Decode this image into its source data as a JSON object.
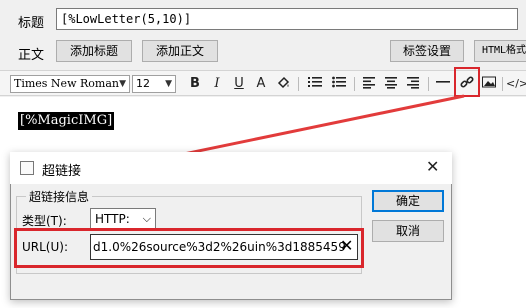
{
  "editor": {
    "title_label": "标题",
    "title_value": "[%LowLetter(5,10)]",
    "body_label": "正文",
    "add_title_btn": "添加标题",
    "add_body_btn": "添加正文",
    "tag_settings_btn": "标签设置",
    "html_btn": "HTML格式"
  },
  "toolbar": {
    "font": "Times New Roman",
    "size": "12",
    "bold": "B",
    "italic": "I",
    "underline": "U",
    "font_color": "A",
    "icons": [
      "bold-icon",
      "italic-icon",
      "underline-icon",
      "font-color-icon",
      "highlight-icon",
      "ordered-list-icon",
      "unordered-list-icon",
      "align-left-icon",
      "align-center-icon",
      "align-right-icon",
      "horizontal-rule-icon",
      "link-icon",
      "image-icon",
      "code-icon"
    ]
  },
  "document": {
    "magic_text": "[%MagicIMG]"
  },
  "dialog": {
    "title": "超链接",
    "group_label": "超链接信息",
    "type_label": "类型(T):",
    "type_value": "HTTP:",
    "url_label": "URL(U):",
    "url_value": "d1.0%26source%3d2%26uin%3d1885459",
    "ok": "确定",
    "cancel": "取消"
  },
  "colors": {
    "highlight": "#d9262c",
    "accent": "#0078d7"
  }
}
